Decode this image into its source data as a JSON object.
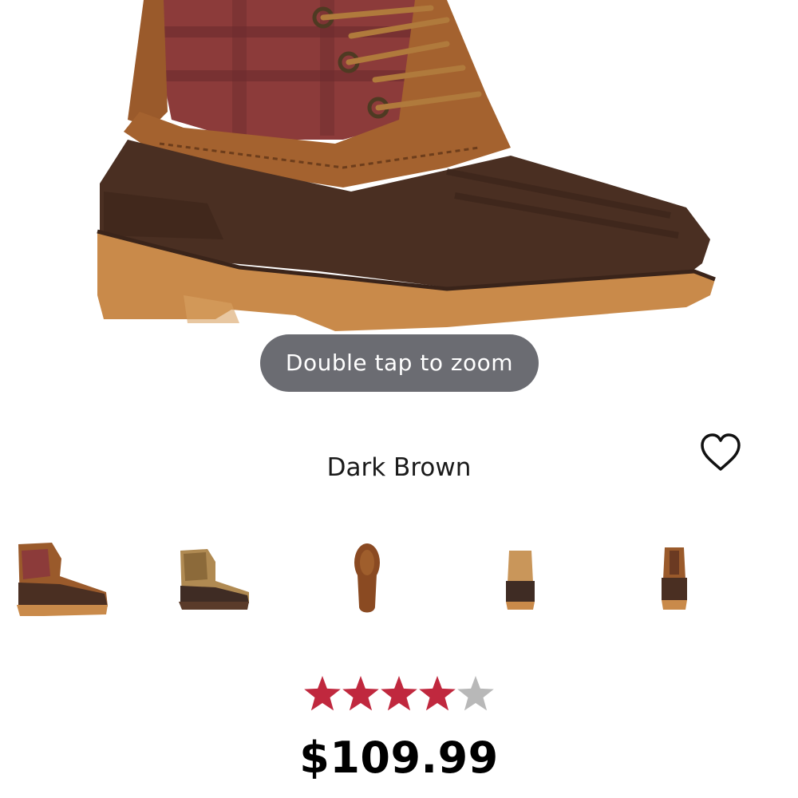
{
  "product_image": {
    "icon": "boot-photo",
    "zoom_hint": "Double tap to zoom"
  },
  "product": {
    "color_name": "Dark Brown",
    "rating": {
      "value": 4,
      "max": 5,
      "filled_color": "#c0283e",
      "empty_color": "#b8b8b8"
    },
    "price": "$109.99"
  },
  "wishlist": {
    "icon": "heart-outline-icon"
  },
  "thumbnails": [
    {
      "view": "side",
      "selected": true
    },
    {
      "view": "side-variant",
      "selected": false
    },
    {
      "view": "sole",
      "selected": false
    },
    {
      "view": "front",
      "selected": false
    },
    {
      "view": "back",
      "selected": false
    }
  ],
  "colors": {
    "leather": "#9a5a2b",
    "rubber": "#4a2f22",
    "sole": "#c98a4a",
    "plaid": "#8c3b3a"
  }
}
